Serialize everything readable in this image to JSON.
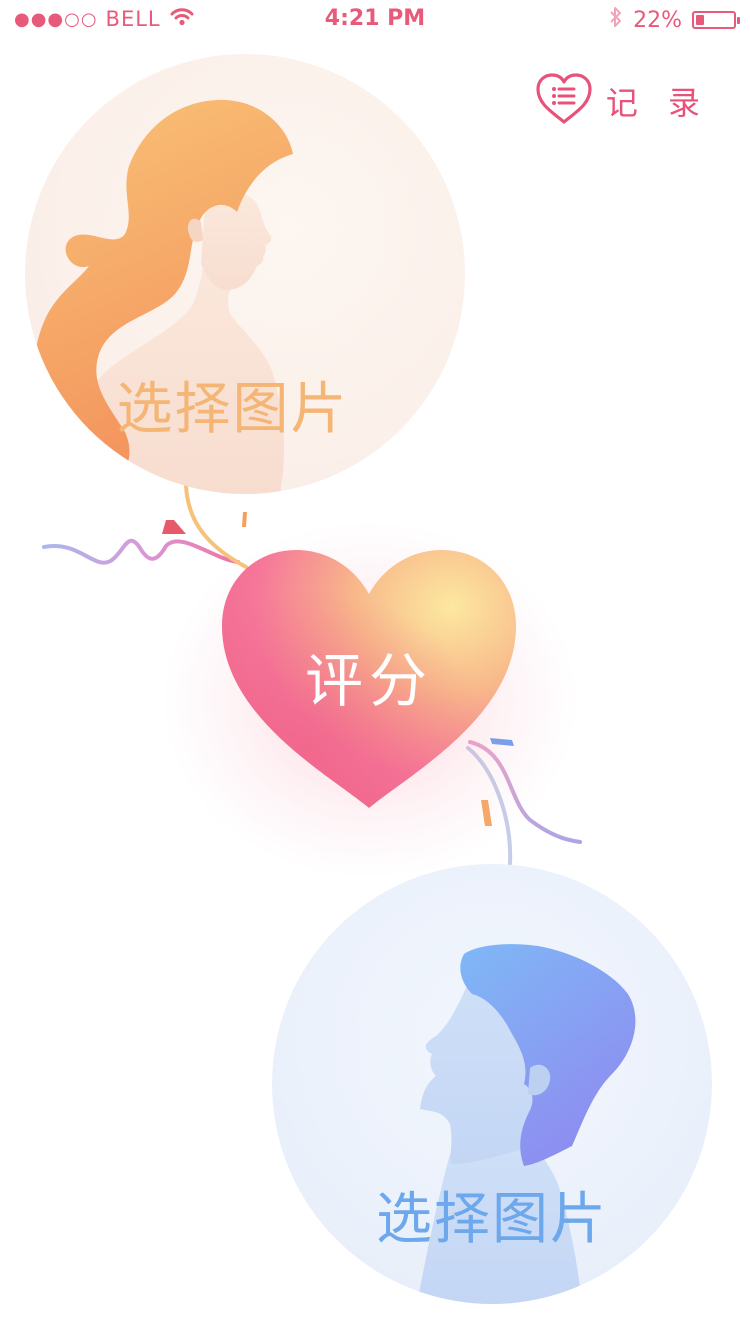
{
  "status_bar": {
    "signal": "●●●○○",
    "carrier": "BELL",
    "time": "4:21 PM",
    "battery_percent": "22%",
    "battery_level": 0.22,
    "icons": [
      "wifi-icon",
      "bluetooth-icon",
      "battery-icon"
    ]
  },
  "header": {
    "record_label": "记 录",
    "record_icon": "heart-list-icon"
  },
  "main": {
    "female_picker_label": "选择图片",
    "male_picker_label": "选择图片",
    "score_label": "评分"
  },
  "colors": {
    "accent": "#e8517a",
    "female_label": "#f4b575",
    "male_label": "#6ea8ec",
    "heart_top": "#fce6a0",
    "heart_bottom": "#f46a8c"
  }
}
